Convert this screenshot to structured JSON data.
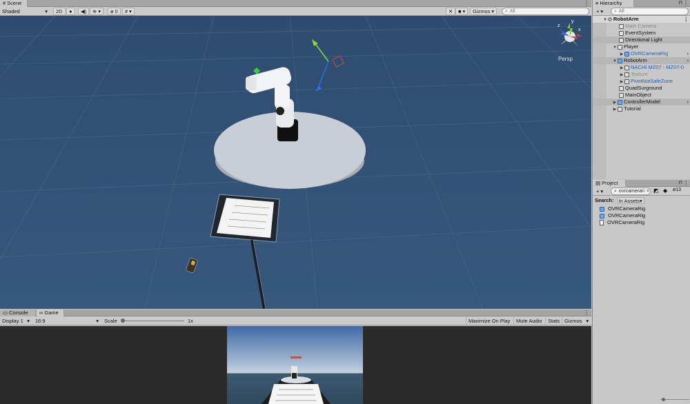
{
  "scene": {
    "tab": "Scene",
    "shading": "Shaded",
    "mode_2d": "2D",
    "hidden_count": "0",
    "gizmos": "Gizmos",
    "search_placeholder": "All",
    "persp": "Persp"
  },
  "hierarchy": {
    "tab": "Hierarchy",
    "search_placeholder": "All",
    "root": "RobotArm",
    "items": [
      {
        "label": "Main Camera"
      },
      {
        "label": "EventSystem"
      },
      {
        "label": "Directional Light"
      },
      {
        "label": "Player"
      },
      {
        "label": "OVRCameraRig"
      },
      {
        "label": "RobotArm"
      },
      {
        "label": "NACHI MZ07 - MZ07-0"
      },
      {
        "label": "Texture"
      },
      {
        "label": "PivotNotSafeZone"
      },
      {
        "label": "QuadSurground"
      },
      {
        "label": "MainObject"
      },
      {
        "label": "ControllerModel"
      },
      {
        "label": "Tutorial"
      }
    ]
  },
  "project": {
    "tab": "Project",
    "search_value": "ovrcamerari",
    "count": "13",
    "search_label": "Search:",
    "scope": "In Assets",
    "results": [
      {
        "label": "OVRCameraRig"
      },
      {
        "label": "OVRCameraRig"
      },
      {
        "label": "OVRCameraRig"
      }
    ]
  },
  "bottom": {
    "console_tab": "Console",
    "game_tab": "Game",
    "display": "Display 1",
    "aspect": "16:9",
    "scale_label": "Scale",
    "scale_value": "1x",
    "maximize": "Maximize On Play",
    "mute": "Mute Audio",
    "stats": "Stats",
    "gizmos": "Gizmos"
  }
}
